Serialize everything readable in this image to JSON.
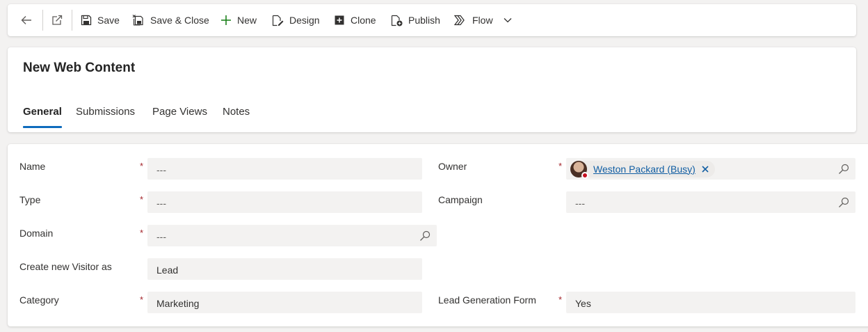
{
  "toolbar": {
    "back_label": "",
    "save_label": "Save",
    "save_close_label": "Save & Close",
    "new_label": "New",
    "design_label": "Design",
    "clone_label": "Clone",
    "publish_label": "Publish",
    "flow_label": "Flow"
  },
  "header": {
    "title": "New Web Content",
    "tabs": [
      {
        "label": "General",
        "active": true
      },
      {
        "label": "Submissions",
        "active": false
      },
      {
        "label": "Page Views",
        "active": false
      },
      {
        "label": "Notes",
        "active": false
      }
    ]
  },
  "form": {
    "name": {
      "label": "Name",
      "required": "*",
      "value": "---"
    },
    "type": {
      "label": "Type",
      "required": "*",
      "value": "---"
    },
    "domain": {
      "label": "Domain",
      "required": "*",
      "value": "---"
    },
    "create_visitor": {
      "label": "Create new Visitor as",
      "value": "Lead"
    },
    "category": {
      "label": "Category",
      "required": "*",
      "value": "Marketing"
    },
    "owner": {
      "label": "Owner",
      "required": "*",
      "value": "Weston Packard (Busy)",
      "presence": "busy"
    },
    "campaign": {
      "label": "Campaign",
      "value": "---"
    },
    "lead_form": {
      "label": "Lead Generation Form",
      "required": "*",
      "value": "Yes"
    }
  },
  "colors": {
    "accent": "#0f6cbd",
    "required": "#a4262c",
    "link": "#115ea3",
    "busy": "#c50f1f"
  }
}
